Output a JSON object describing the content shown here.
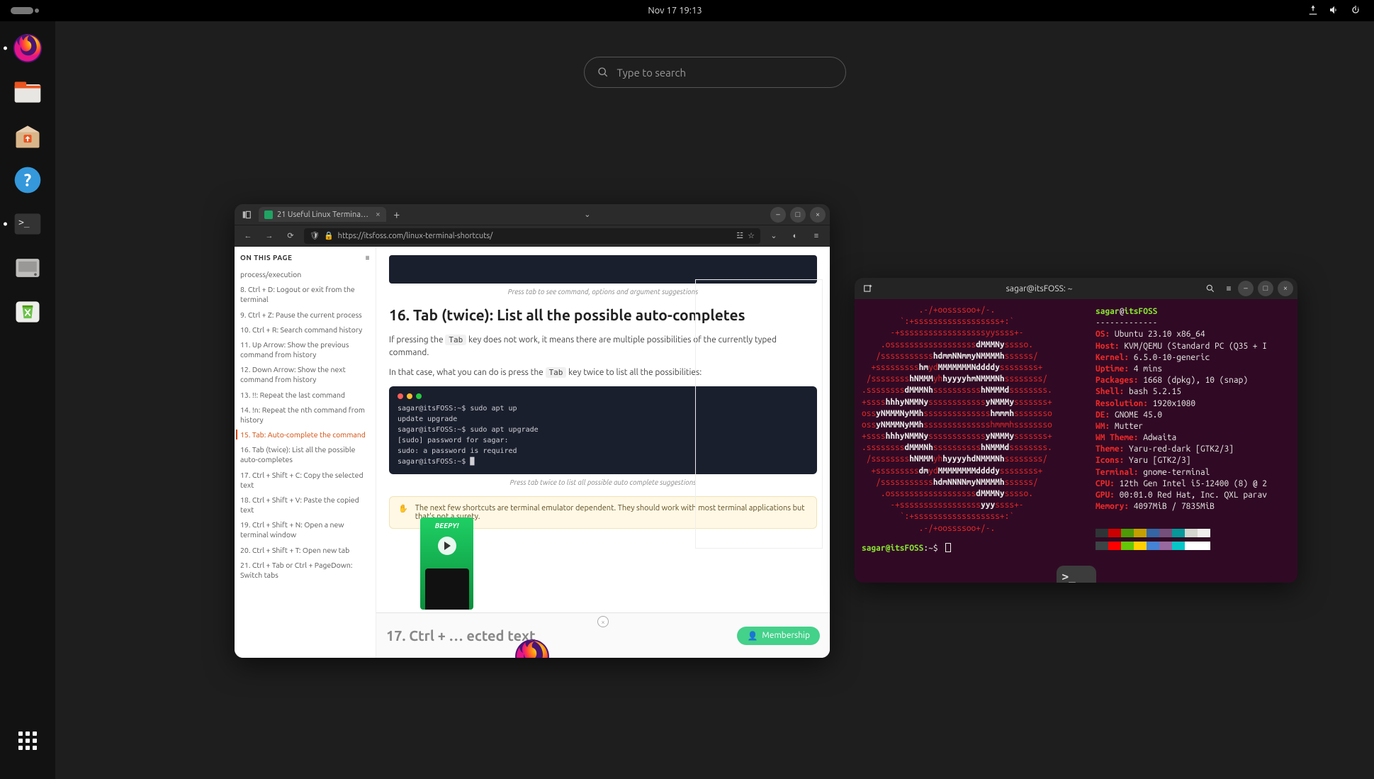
{
  "topbar": {
    "datetime": "Nov 17  19:13"
  },
  "search": {
    "placeholder": "Type to search"
  },
  "dock": {
    "items": [
      "firefox",
      "files",
      "software",
      "help",
      "terminal",
      "disk",
      "trash"
    ]
  },
  "firefox": {
    "tab_title": "21 Useful Linux Termina…",
    "url": "https://itsfoss.com/linux-terminal-shortcuts/",
    "toc_header": "ON THIS PAGE",
    "toc": [
      "process/execution",
      "8. Ctrl + D: Logout or exit from the terminal",
      "9. Ctrl + Z: Pause the current process",
      "10. Ctrl + R: Search command history",
      "11. Up Arrow: Show the previous command from history",
      "12. Down Arrow: Show the next command from history",
      "13. !!: Repeat the last command",
      "14. !n: Repeat the nth command from history",
      "15. Tab: Auto-complete the command",
      "16. Tab (twice): List all the possible auto-completes",
      "17. Ctrl + Shift + C: Copy the selected text",
      "18. Ctrl + Shift + V: Paste the copied text",
      "19. Ctrl + Shift + N: Open a new terminal window",
      "20. Ctrl + Shift + T: Open new tab",
      "21. Ctrl + Tab or Ctrl + PageDown: Switch tabs"
    ],
    "toc_active_index": 8,
    "caption1": "Press tab to see command, options and argument suggestions",
    "heading": "16. Tab (twice): List all the possible auto-completes",
    "para1a": "If pressing the ",
    "para1code": "Tab",
    "para1b": " key does not work, it means there are multiple possibilities of the currently typed command.",
    "para2a": "In that case, what you can do is press the ",
    "para2code": "Tab",
    "para2b": " key twice to list all the possibilities:",
    "code": [
      "sagar@itsFOSS:~$ sudo apt up",
      "update   upgrade",
      "sagar@itsFOSS:~$ sudo apt upgrade",
      "[sudo] password for sagar:",
      "sudo: a password is required",
      "sagar@itsFOSS:~$ █"
    ],
    "caption2": "Press tab twice to list all possible auto complete suggestions",
    "note": "The next few shortcuts are terminal emulator dependent. They should work with most terminal applications but that's not a surety.",
    "next_heading": "17. Ctrl + … ected text",
    "membership": "Membership",
    "beepy": "BEEPY!"
  },
  "terminal": {
    "title": "sagar@itsFOSS: ~",
    "prompt_user": "sagar@itsFOSS",
    "prompt_path": ":~$",
    "info": {
      "userhost": "sagar@itsFOSS",
      "sep": "-------------",
      "OS": "Ubuntu 23.10 x86_64",
      "Host": "KVM/QEMU (Standard PC (Q35 + I",
      "Kernel": "6.5.0-10-generic",
      "Uptime": "4 mins",
      "Packages": "1668 (dpkg), 10 (snap)",
      "Shell": "bash 5.2.15",
      "Resolution": "1920x1080",
      "DE": "GNOME 45.0",
      "WM": "Mutter",
      "WM Theme": "Adwaita",
      "Theme": "Yaru-red-dark [GTK2/3]",
      "Icons": "Yaru [GTK2/3]",
      "Terminal": "gnome-terminal",
      "CPU": "12th Gen Intel i5-12400 (8) @ 2",
      "GPU": "00:01.0 Red Hat, Inc. QXL parav",
      "Memory": "4097MiB / 7835MiB"
    },
    "swatches": [
      "#2e3436",
      "#cc0000",
      "#4e9a06",
      "#c4a000",
      "#3465a4",
      "#75507b",
      "#06989a",
      "#d3d7cf",
      "#eeeeec"
    ]
  }
}
